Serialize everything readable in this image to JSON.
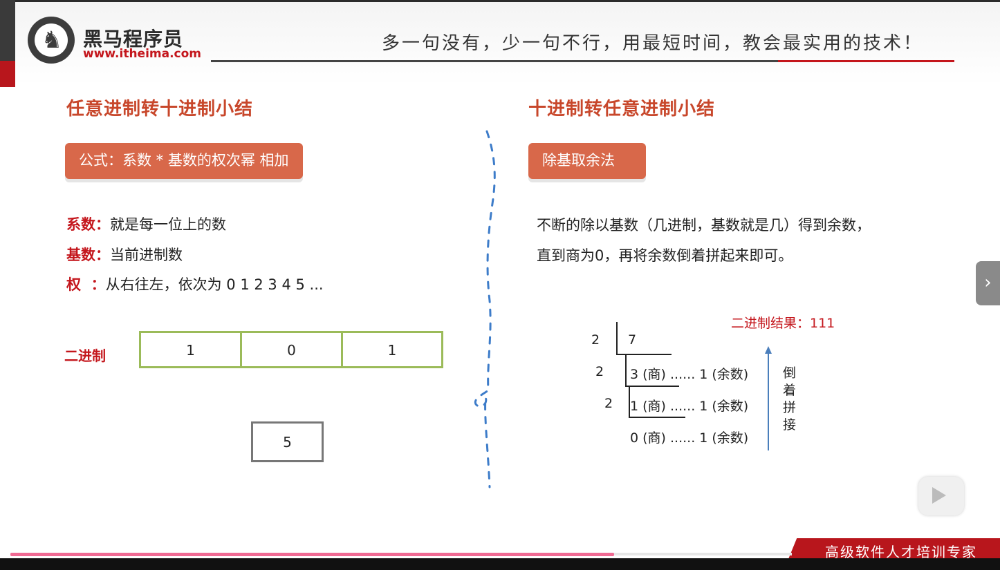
{
  "header": {
    "brand_name": "黑马程序员",
    "brand_url": "www.itheima.com",
    "slogan": "多一句没有，少一句不行，用最短时间，教会最实用的技术！"
  },
  "left": {
    "title": "任意进制转十进制小结",
    "formula": "公式：系数 * 基数的权次幂 相加",
    "defs": [
      {
        "label": "系数：",
        "text": "就是每一位上的数"
      },
      {
        "label": "基数：",
        "text": "当前进制数"
      },
      {
        "label": "权  ：",
        "text": "从右往左，依次为 0 1 2 3 4 5 ..."
      }
    ],
    "binary_label": "二进制",
    "binary_digits": [
      "1",
      "0",
      "1"
    ],
    "result": "5"
  },
  "right": {
    "title": "十进制转任意进制小结",
    "method": "除基取余法",
    "desc_line1": "不断的除以基数（几进制，基数就是几）得到余数，",
    "desc_line2": "直到商为0，再将余数倒着拼起来即可。",
    "result_label": "二进制结果：111",
    "division": {
      "divisors": [
        "2",
        "2",
        "2"
      ],
      "dividend": "7",
      "rows": [
        "3 (商) ...... 1 (余数)",
        "1 (商) ...... 1 (余数)",
        "0 (商) ...... 1 (余数)"
      ]
    },
    "arrow_label": [
      "倒",
      "着",
      "拼",
      "接"
    ]
  },
  "footer": {
    "tagline": "高级软件人才培训专家"
  },
  "colors": {
    "accent_red": "#c4161c",
    "title_orange": "#c8472b",
    "pill": "#d8684a",
    "table_green": "#9bbb59",
    "progress": "#f06a93"
  },
  "player": {
    "progress": 0.773
  }
}
